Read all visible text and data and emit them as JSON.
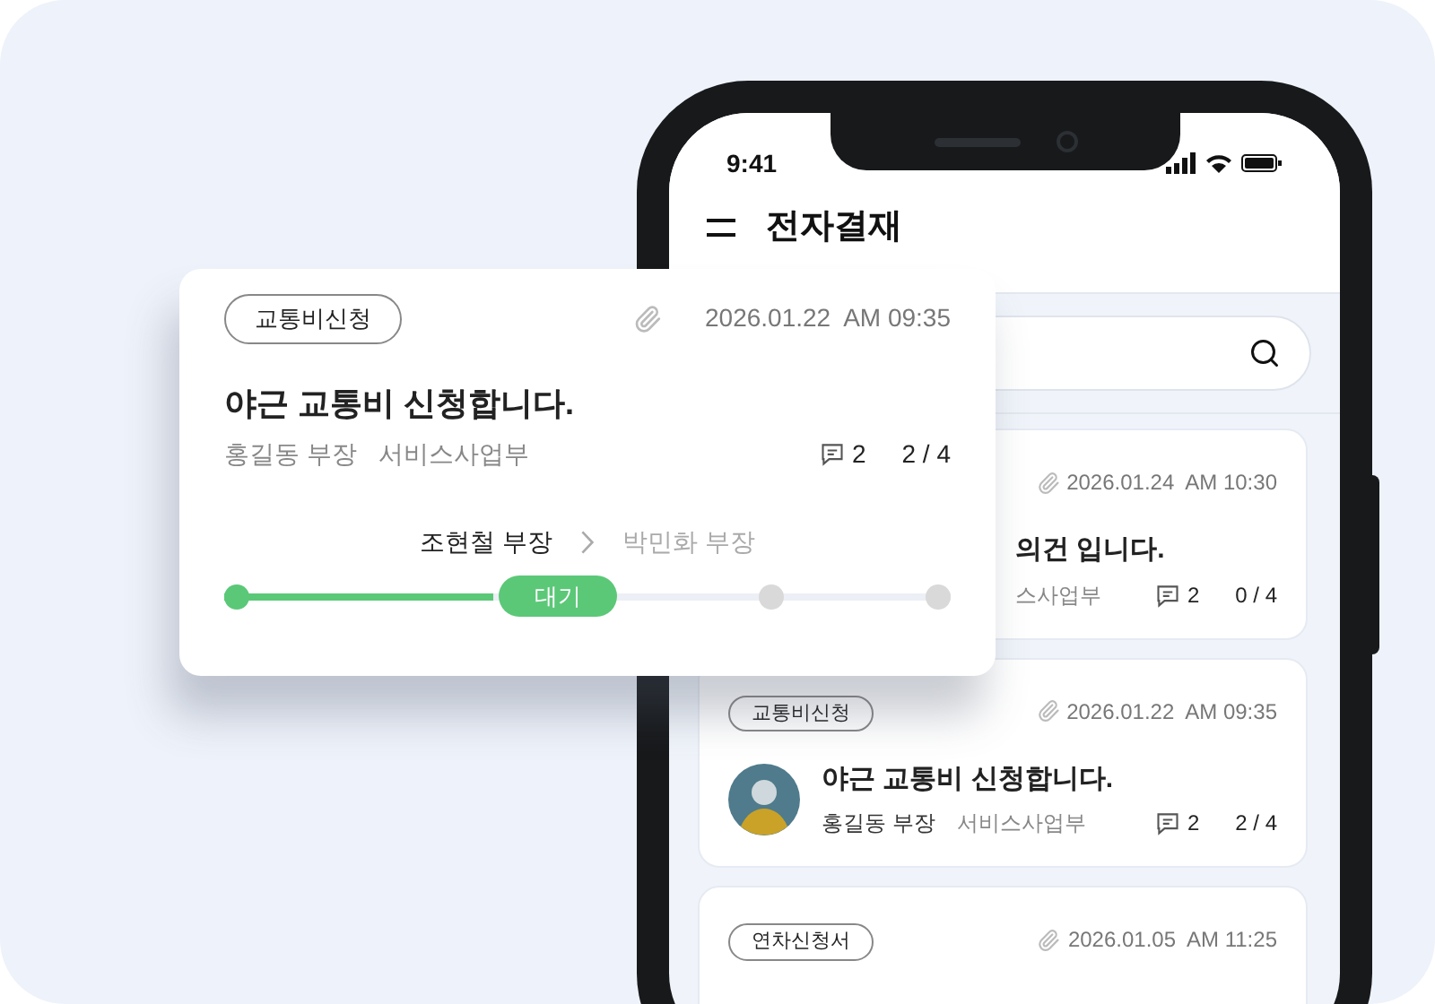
{
  "phone": {
    "status_bar": {
      "time": "9:41"
    },
    "header": {
      "title": "전자결재"
    },
    "list": [
      {
        "date": "2026.01.24  AM 10:30",
        "attachment": true,
        "title": "의건 입니다.",
        "dept": "스사업부",
        "comments": "2",
        "progress": "0 / 4"
      },
      {
        "tag": "교통비신청",
        "date": "2026.01.22  AM 09:35",
        "attachment": true,
        "avatar": true,
        "title": "야근 교통비 신청합니다.",
        "author": "홍길동 부장",
        "dept": "서비스사업부",
        "comments": "2",
        "progress": "2 / 4"
      },
      {
        "tag": "연차신청서",
        "date": "2026.01.05  AM 11:25",
        "attachment": true
      }
    ]
  },
  "detail_card": {
    "tag": "교통비신청",
    "attachment": true,
    "date": "2026.01.22  AM 09:35",
    "title": "야근 교통비 신청합니다.",
    "author": "홍길동 부장",
    "dept": "서비스사업부",
    "comments": "2",
    "progress": "2 / 4",
    "approval": {
      "current": "조현철 부장",
      "next": "박민화 부장"
    },
    "level": 0.37,
    "steps": [
      {
        "kind": "done"
      },
      {
        "kind": "current",
        "label": "대기"
      },
      {
        "kind": "pending"
      },
      {
        "kind": "pending"
      }
    ]
  }
}
